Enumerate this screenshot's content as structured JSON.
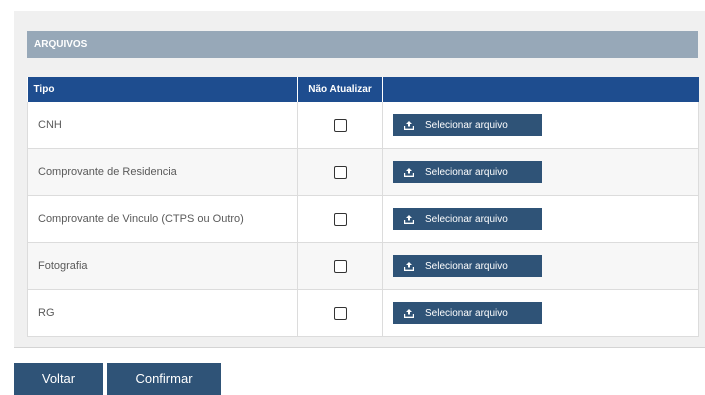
{
  "section": {
    "title": "ARQUIVOS"
  },
  "table": {
    "headers": {
      "tipo": "Tipo",
      "nao_atualizar": "Não Atualizar",
      "action": ""
    },
    "upload_label": "Selecionar arquivo",
    "upload_icon": "upload-icon",
    "rows": [
      {
        "tipo": "CNH",
        "nao_atualizar": false
      },
      {
        "tipo": "Comprovante de Residencia",
        "nao_atualizar": false
      },
      {
        "tipo": "Comprovante de Vinculo (CTPS ou Outro)",
        "nao_atualizar": false
      },
      {
        "tipo": "Fotografia",
        "nao_atualizar": false
      },
      {
        "tipo": "RG",
        "nao_atualizar": false
      }
    ]
  },
  "footer": {
    "voltar_label": "Voltar",
    "confirmar_label": "Confirmar"
  },
  "colors": {
    "header_blue": "#1e4d8f",
    "button_blue": "#2f5377",
    "section_gray": "#97a8b8"
  }
}
